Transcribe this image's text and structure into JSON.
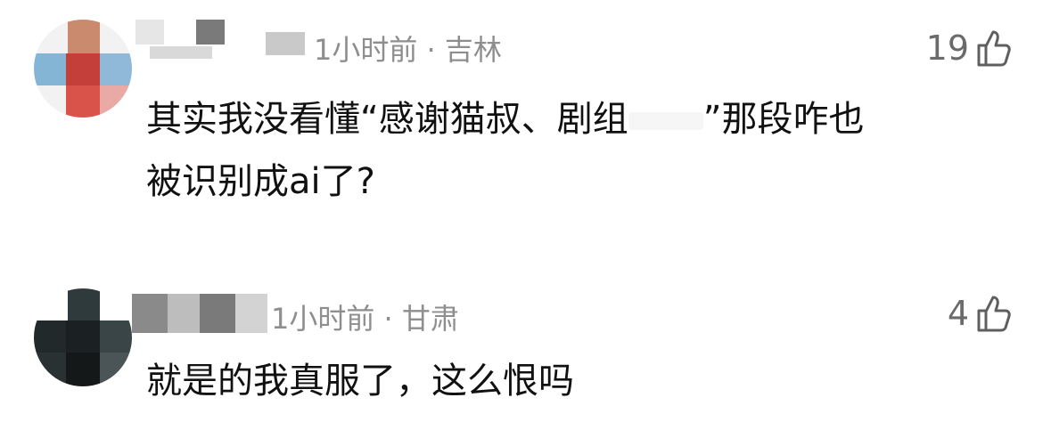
{
  "comments": [
    {
      "meta": "1小时前 · 吉林",
      "likes": "19",
      "text_line1_a": "其实我没看懂“感谢猫叔、剧组",
      "text_line1_b": "”那段咋也",
      "text_line2": "被识别成ai了?",
      "icon": "thumbs-up-icon"
    },
    {
      "meta": "1小时前 · 甘肃",
      "likes": "4",
      "text": "就是的我真服了，这么恨吗",
      "icon": "thumbs-up-icon"
    }
  ]
}
